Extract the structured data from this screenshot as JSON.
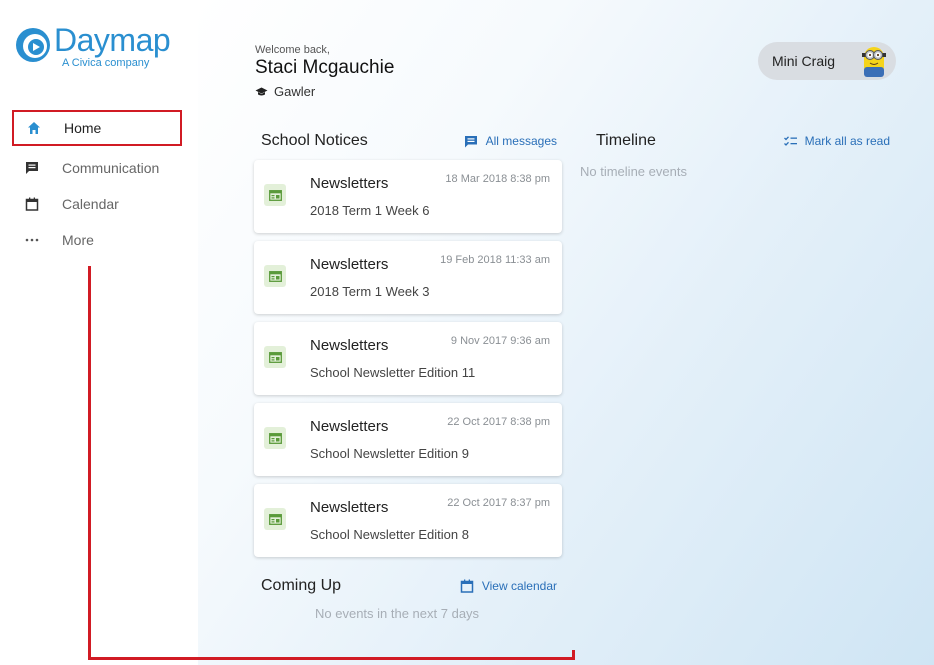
{
  "logo": {
    "name": "Daymap",
    "subtitle": "A Civica company"
  },
  "nav": [
    {
      "label": "Home",
      "icon": "home-icon",
      "active": true
    },
    {
      "label": "Communication",
      "icon": "message-icon"
    },
    {
      "label": "Calendar",
      "icon": "calendar-icon"
    },
    {
      "label": "More",
      "icon": "more-icon"
    }
  ],
  "welcome": {
    "greeting": "Welcome back,",
    "name": "Staci Mcgauchie",
    "school": "Gawler"
  },
  "user": {
    "name": "Mini Craig",
    "avatar": "minion-avatar"
  },
  "notices": {
    "title": "School Notices",
    "link": "All messages",
    "items": [
      {
        "title": "Newsletters",
        "date": "18 Mar 2018 8:38 pm",
        "subtitle": "2018 Term 1 Week 6"
      },
      {
        "title": "Newsletters",
        "date": "19 Feb 2018 11:33 am",
        "subtitle": "2018 Term 1 Week 3"
      },
      {
        "title": "Newsletters",
        "date": "9 Nov 2017 9:36 am",
        "subtitle": "School Newsletter Edition 11"
      },
      {
        "title": "Newsletters",
        "date": "22 Oct 2017 8:38 pm",
        "subtitle": "School Newsletter Edition 9"
      },
      {
        "title": "Newsletters",
        "date": "22 Oct 2017 8:37 pm",
        "subtitle": "School Newsletter Edition 8"
      }
    ]
  },
  "timeline": {
    "title": "Timeline",
    "link": "Mark all as read",
    "empty": "No timeline events"
  },
  "coming_up": {
    "title": "Coming Up",
    "link": "View calendar",
    "empty": "No events in the next 7 days"
  },
  "colors": {
    "accent": "#2a8fd0",
    "link": "#2a6fb8",
    "annotation": "#d11b24",
    "notice_icon_bg": "#e3f0d9"
  }
}
